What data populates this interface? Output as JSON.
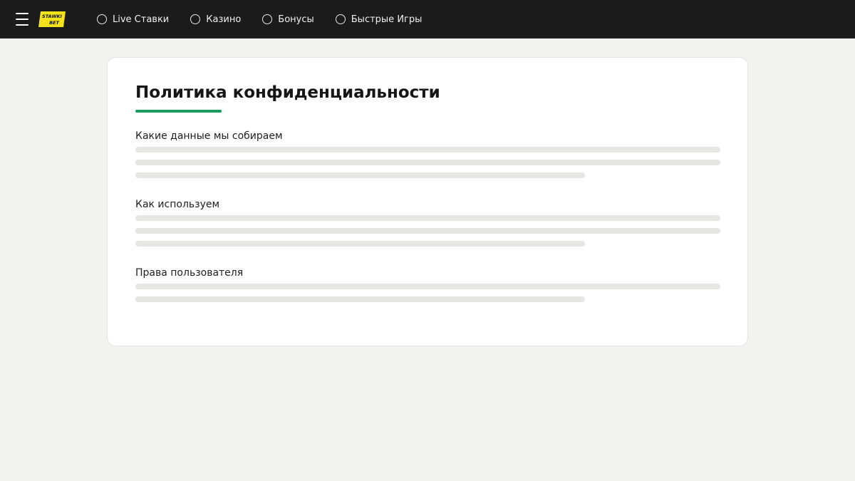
{
  "header": {
    "menu_icon": "hamburger-menu-icon",
    "logo": {
      "line1": "STAWKI",
      "line2": "BET",
      "color": "#f4e21a"
    },
    "nav": [
      {
        "label": "Live Ставки",
        "icon": "radio-circle-icon"
      },
      {
        "label": "Казино",
        "icon": "radio-circle-icon"
      },
      {
        "label": "Бонусы",
        "icon": "radio-circle-icon"
      },
      {
        "label": "Быстрые Игры",
        "icon": "radio-circle-icon"
      }
    ]
  },
  "page": {
    "title": "Политика конфиденциальности",
    "accent_color": "#1a9a5c",
    "sections": [
      {
        "heading": "Какие данные мы собираем"
      },
      {
        "heading": "Как используем"
      },
      {
        "heading": "Права пользователя"
      }
    ]
  },
  "colors": {
    "header_bg": "#1b1b1b",
    "page_bg": "#f2f2ee",
    "card_bg": "#ffffff",
    "skeleton": "#e6e6e4"
  }
}
